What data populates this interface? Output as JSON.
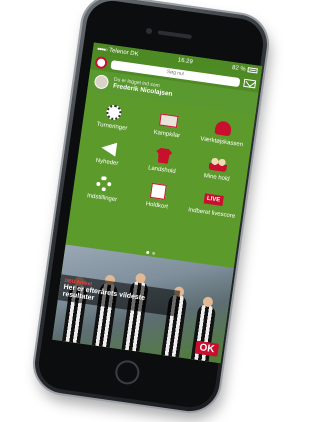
{
  "status_bar": {
    "carrier": "Telenor DK",
    "time": "16.29",
    "battery": "82 %"
  },
  "nav": {
    "search_placeholder": "Søg nu!"
  },
  "user": {
    "status": "Du er logget ind som",
    "name": "Frederik Nicolajsen"
  },
  "menu": {
    "items": [
      {
        "label": "Turneringer",
        "icon": "football-icon"
      },
      {
        "label": "Kampkilar",
        "icon": "schedule-icon"
      },
      {
        "label": "Værktøjskassen",
        "icon": "toolbox-icon"
      },
      {
        "label": "Nyheder",
        "icon": "megaphone-icon"
      },
      {
        "label": "Landshold",
        "icon": "jersey-icon"
      },
      {
        "label": "Mine hold",
        "icon": "team-icon"
      },
      {
        "label": "Indstillinger",
        "icon": "gear-icon"
      },
      {
        "label": "Holdkort",
        "icon": "card-icon"
      },
      {
        "label": "Indberet livescore",
        "icon": "live-icon",
        "badge": "LIVE"
      }
    ]
  },
  "pager": {
    "count": 2,
    "active": 1
  },
  "banner": {
    "tag": "DBU Artikel",
    "title": "Her er efterårets vildeste resultater",
    "sponsor": "OK"
  }
}
